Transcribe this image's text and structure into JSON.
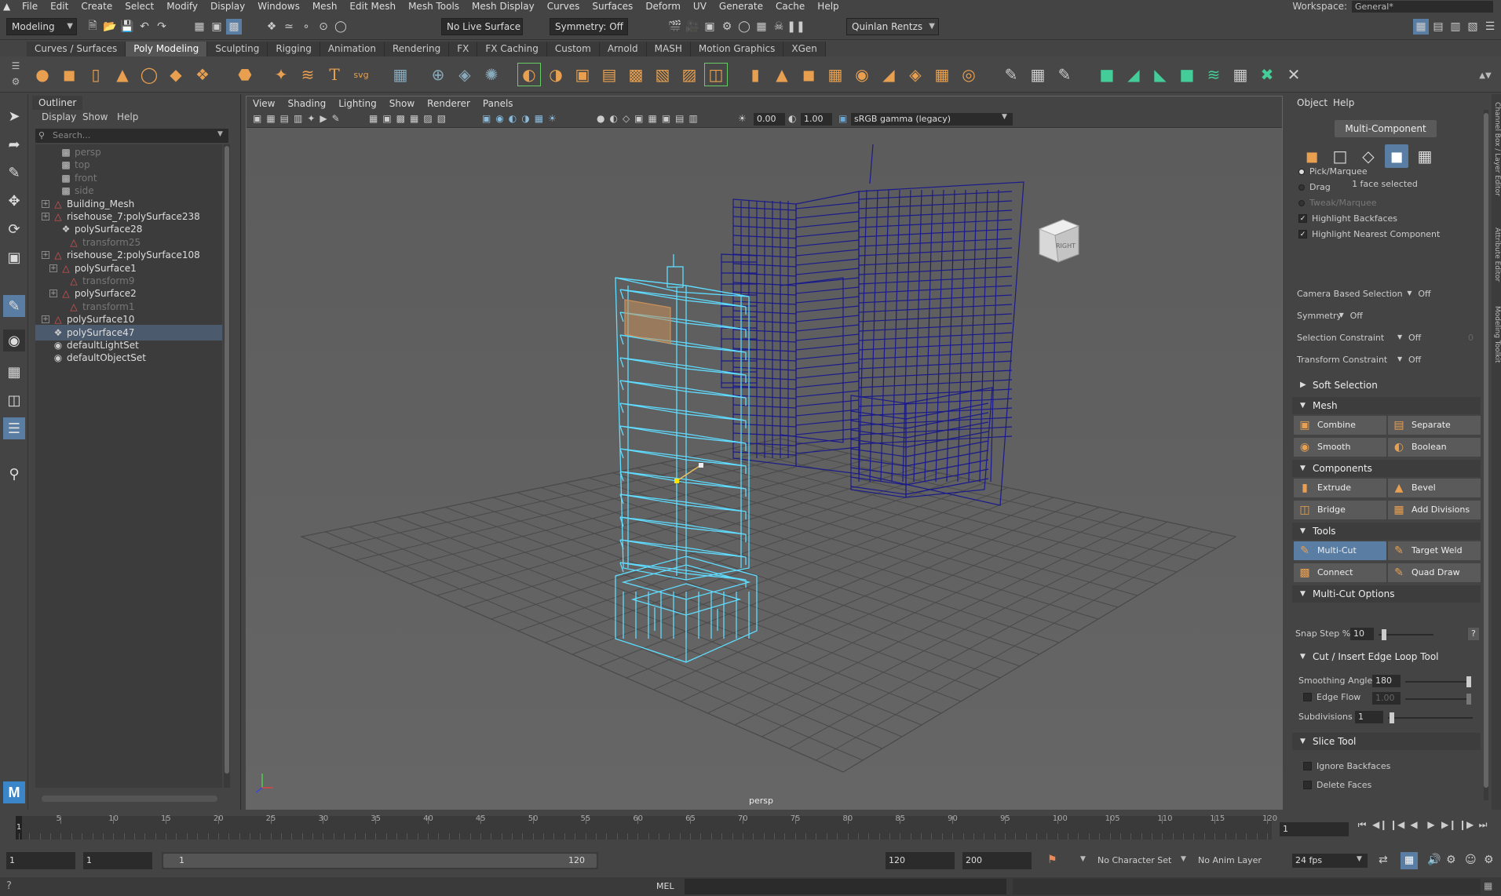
{
  "menubar": {
    "items": [
      "File",
      "Edit",
      "Create",
      "Select",
      "Modify",
      "Display",
      "Windows",
      "Mesh",
      "Edit Mesh",
      "Mesh Tools",
      "Mesh Display",
      "Curves",
      "Surfaces",
      "Deform",
      "UV",
      "Generate",
      "Cache",
      "Help"
    ],
    "workspace_label": "Workspace:",
    "workspace_value": "General*"
  },
  "statusline": {
    "mode": "Modeling",
    "live_surface": "No Live Surface",
    "symmetry": "Symmetry: Off",
    "user": "Quinlan Rentzs"
  },
  "shelf": {
    "tabs": [
      "Curves / Surfaces",
      "Poly Modeling",
      "Sculpting",
      "Rigging",
      "Animation",
      "Rendering",
      "FX",
      "FX Caching",
      "Custom",
      "Arnold",
      "MASH",
      "Motion Graphics",
      "XGen"
    ],
    "active_tab": "Poly Modeling"
  },
  "outliner": {
    "title": "Outliner",
    "menu": [
      "Display",
      "Show",
      "Help"
    ],
    "search_placeholder": "Search...",
    "items": [
      {
        "label": "persp",
        "dim": true
      },
      {
        "label": "top",
        "dim": true
      },
      {
        "label": "front",
        "dim": true
      },
      {
        "label": "side",
        "dim": true
      },
      {
        "label": "Building_Mesh",
        "dim": false
      },
      {
        "label": "risehouse_7:polySurface238",
        "dim": false
      },
      {
        "label": "polySurface28",
        "dim": false
      },
      {
        "label": "transform25",
        "dim": true
      },
      {
        "label": "risehouse_2:polySurface108",
        "dim": false
      },
      {
        "label": "polySurface1",
        "dim": false
      },
      {
        "label": "transform9",
        "dim": true
      },
      {
        "label": "polySurface2",
        "dim": false
      },
      {
        "label": "transform1",
        "dim": true
      },
      {
        "label": "polySurface10",
        "dim": false
      },
      {
        "label": "polySurface47",
        "dim": false
      },
      {
        "label": "defaultLightSet",
        "dim": false
      },
      {
        "label": "defaultObjectSet",
        "dim": false
      }
    ],
    "selected_item": "polySurface47"
  },
  "viewport": {
    "menu": [
      "View",
      "Shading",
      "Lighting",
      "Show",
      "Renderer",
      "Panels"
    ],
    "exposure": "0.00",
    "gamma": "1.00",
    "color_space": "sRGB gamma (legacy)",
    "camera_label": "persp",
    "cube_label": "RIGHT"
  },
  "modeling_toolkit": {
    "menu": [
      "Object",
      "Help"
    ],
    "mode_button": "Multi-Component",
    "selection_info": "1 face selected",
    "pick_options": [
      {
        "label": "Pick/Marquee",
        "on": true,
        "dim": false
      },
      {
        "label": "Drag",
        "on": false,
        "dim": false
      },
      {
        "label": "Tweak/Marquee",
        "on": false,
        "dim": true
      }
    ],
    "checks": [
      {
        "label": "Highlight Backfaces",
        "checked": true
      },
      {
        "label": "Highlight Nearest Component",
        "checked": true
      }
    ],
    "settings": [
      {
        "label": "Camera Based Selection",
        "value": "Off"
      },
      {
        "label": "Symmetry",
        "value": "Off"
      },
      {
        "label": "Selection Constraint",
        "value": "Off",
        "extra": "0"
      },
      {
        "label": "Transform Constraint",
        "value": "Off"
      }
    ],
    "soft_selection": "Soft Selection",
    "sections": {
      "mesh": "Mesh",
      "components": "Components",
      "tools": "Tools",
      "multicut_options": "Multi-Cut Options",
      "cut_insert": "Cut / Insert Edge Loop Tool",
      "slice_tool": "Slice Tool"
    },
    "mesh_buttons": [
      "Combine",
      "Separate",
      "Smooth",
      "Boolean"
    ],
    "component_buttons": [
      "Extrude",
      "Bevel",
      "Bridge",
      "Add Divisions"
    ],
    "tool_buttons": [
      "Multi-Cut",
      "Target Weld",
      "Connect",
      "Quad Draw"
    ],
    "active_tool": "Multi-Cut",
    "snap_step": {
      "label": "Snap Step %",
      "value": "10",
      "help": "?"
    },
    "smoothing_angle": {
      "label": "Smoothing Angle",
      "value": "180"
    },
    "edge_flow": {
      "label": "Edge Flow",
      "value": "1.00"
    },
    "subdivisions": {
      "label": "Subdivisions",
      "value": "1"
    },
    "slice_checks": [
      "Ignore Backfaces",
      "Delete Faces"
    ]
  },
  "side_tabs": [
    "Channel Box / Layer Editor",
    "Attribute Editor",
    "Modeling Toolkit"
  ],
  "timeline": {
    "ticks": [
      "5",
      "10",
      "15",
      "20",
      "25",
      "30",
      "35",
      "40",
      "45",
      "50",
      "55",
      "60",
      "65",
      "70",
      "75",
      "80",
      "85",
      "90",
      "95",
      "100",
      "105",
      "110",
      "115",
      "120"
    ],
    "current_frame": "1",
    "frame_field": "1"
  },
  "range": {
    "start": "1",
    "start2": "1",
    "range_start": "1",
    "range_end": "120",
    "end": "120",
    "end2": "200",
    "character_set": "No Character Set",
    "anim_layer": "No Anim Layer",
    "fps": "24 fps"
  },
  "cmdline": {
    "label": "MEL"
  }
}
